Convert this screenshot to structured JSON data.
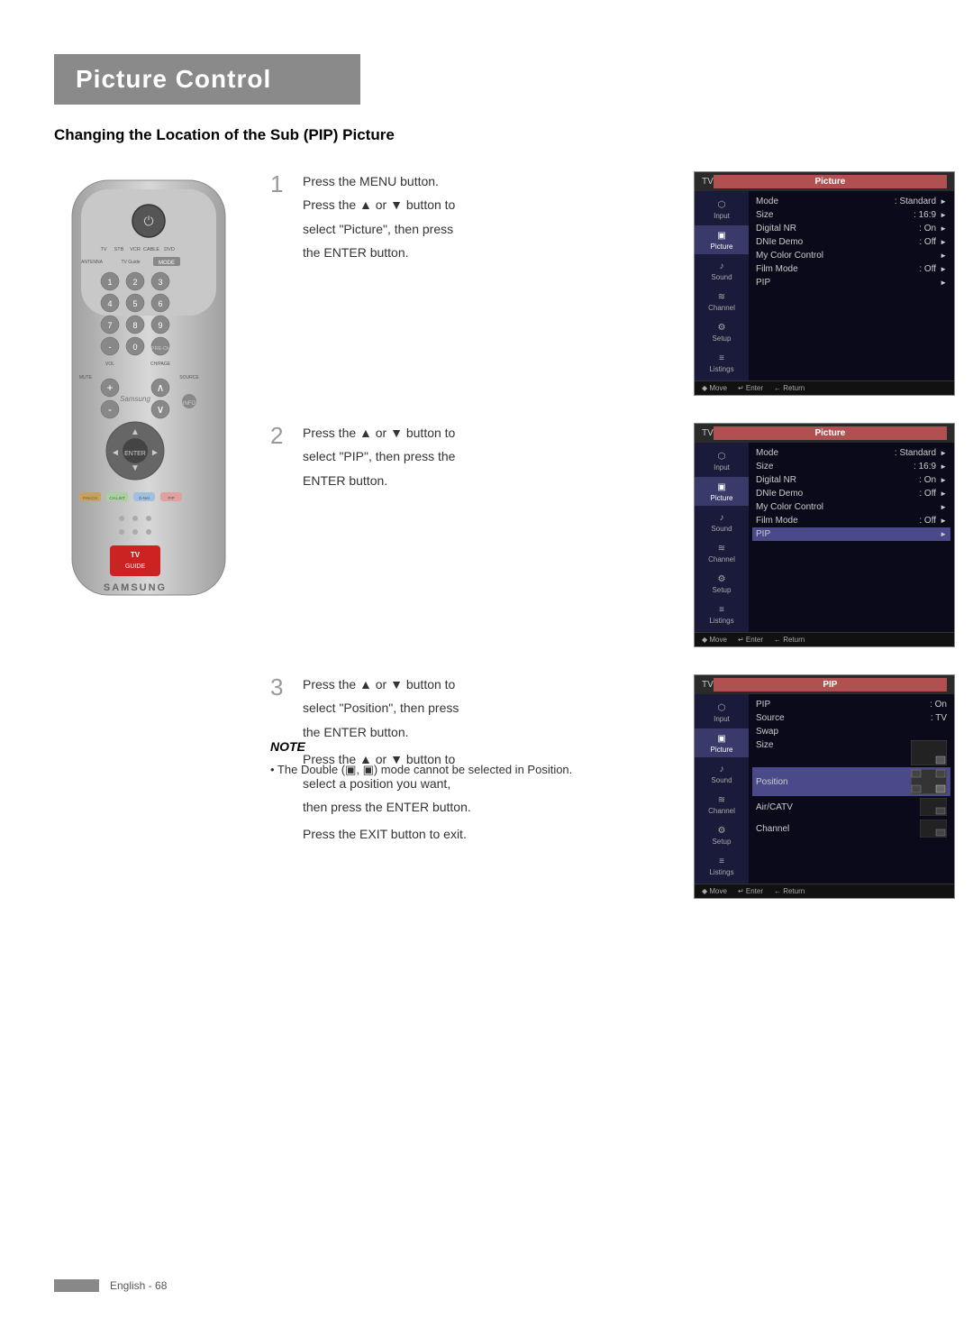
{
  "page": {
    "title": "Picture Control",
    "section_heading": "Changing the Location of the Sub (PIP) Picture",
    "footer_text": "English - 68"
  },
  "steps": [
    {
      "number": "1",
      "lines": [
        "Press the MENU button.",
        "Press the ▲ or ▼ button to",
        "select \"Picture\", then press",
        "the ENTER button."
      ],
      "menu_title": "Picture",
      "menu_header": "TV",
      "sidebar_items": [
        "Input",
        "Picture",
        "Sound",
        "Channel",
        "Setup",
        "Listings"
      ],
      "active_sidebar": "Picture",
      "menu_rows": [
        {
          "label": "Mode",
          "value": ": Standard",
          "arrow": true
        },
        {
          "label": "Size",
          "value": ": 16:9",
          "arrow": true
        },
        {
          "label": "Digital NR",
          "value": ": On",
          "arrow": true
        },
        {
          "label": "DNIe Demo",
          "value": ": Off",
          "arrow": true
        },
        {
          "label": "My Color Control",
          "value": "",
          "arrow": true
        },
        {
          "label": "Film Mode",
          "value": ": Off",
          "arrow": true
        },
        {
          "label": "PIP",
          "value": "",
          "arrow": true
        }
      ]
    },
    {
      "number": "2",
      "lines": [
        "Press the ▲ or ▼ button to",
        "select \"PIP\", then press the",
        "ENTER button."
      ],
      "menu_title": "Picture",
      "menu_header": "TV",
      "sidebar_items": [
        "Input",
        "Picture",
        "Sound",
        "Channel",
        "Setup",
        "Listings"
      ],
      "active_sidebar": "Picture",
      "menu_rows": [
        {
          "label": "Mode",
          "value": ": Standard",
          "arrow": true
        },
        {
          "label": "Size",
          "value": ": 16:9",
          "arrow": true
        },
        {
          "label": "Digital NR",
          "value": ": On",
          "arrow": true
        },
        {
          "label": "DNIe Demo",
          "value": ": Off",
          "arrow": true
        },
        {
          "label": "My Color Control",
          "value": "",
          "arrow": true
        },
        {
          "label": "Film Mode",
          "value": ": Off",
          "arrow": true
        },
        {
          "label": "PIP",
          "value": "",
          "arrow": true,
          "highlighted": true
        }
      ]
    },
    {
      "number": "3",
      "lines": [
        "Press the ▲ or ▼ button to",
        "select \"Position\", then press",
        "the ENTER button.",
        "",
        "Press the ▲ or ▼ button to",
        "select a position you want,",
        "then press the ENTER button.",
        "",
        "Press the EXIT button to exit."
      ],
      "menu_title": "PIP",
      "menu_header": "TV",
      "sidebar_items": [
        "Input",
        "Picture",
        "Sound",
        "Channel",
        "Setup",
        "Listings"
      ],
      "active_sidebar": "Picture",
      "menu_rows": [
        {
          "label": "PIP",
          "value": ": On",
          "arrow": false
        },
        {
          "label": "Source",
          "value": ": TV",
          "arrow": false
        },
        {
          "label": "Swap",
          "value": "",
          "arrow": false
        },
        {
          "label": "Size",
          "value": "",
          "arrow": false,
          "pip_size": true
        },
        {
          "label": "Position",
          "value": "",
          "arrow": false,
          "highlighted": true,
          "pip_pos": true
        },
        {
          "label": "Air/CATV",
          "value": "",
          "arrow": false
        },
        {
          "label": "Channel",
          "value": "",
          "arrow": false
        }
      ]
    }
  ],
  "note": {
    "title": "NOTE",
    "bullet": "• The Double (▣, ▣) mode cannot be selected in Position."
  },
  "sidebar_icons": {
    "Input": "⬡",
    "Picture": "▣",
    "Sound": "♪",
    "Channel": "📺",
    "Setup": "⚙",
    "Listings": "≡"
  }
}
